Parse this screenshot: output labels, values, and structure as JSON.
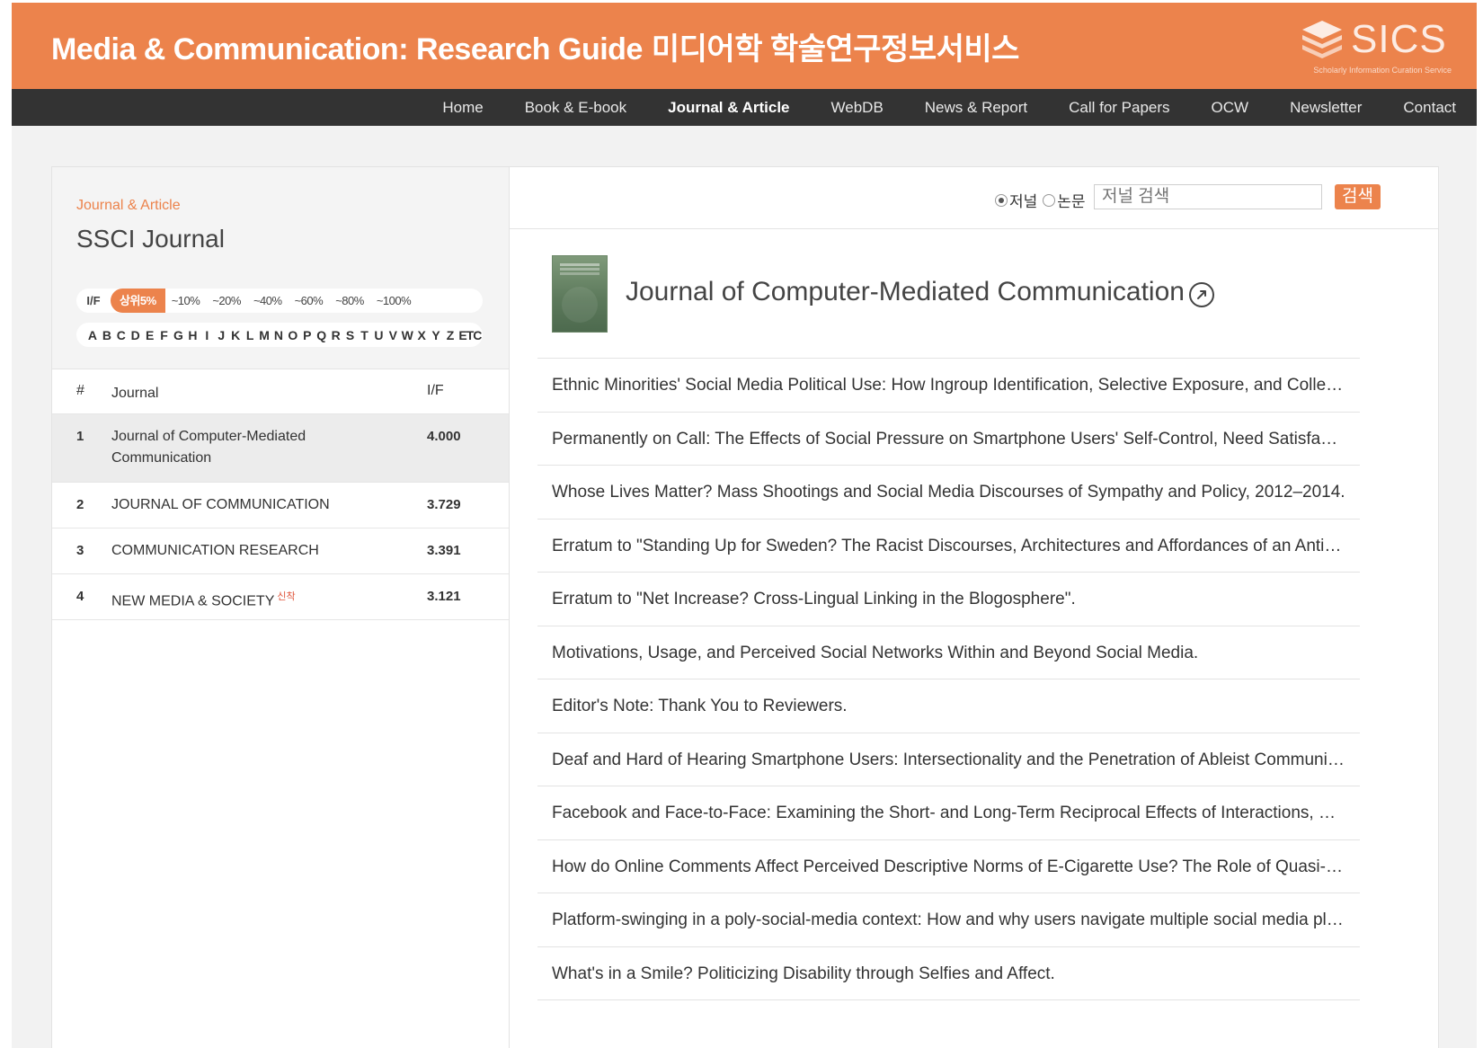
{
  "header": {
    "title_en": "Media & Communication: Research Guide",
    "title_ko": "미디어학 학술연구정보서비스",
    "logo_text": "SICS",
    "logo_sub": "Scholarly Information Curation Service"
  },
  "nav": {
    "items": [
      {
        "label": "Home",
        "active": false
      },
      {
        "label": "Book & E-book",
        "active": false
      },
      {
        "label": "Journal & Article",
        "active": true
      },
      {
        "label": "WebDB",
        "active": false
      },
      {
        "label": "News & Report",
        "active": false
      },
      {
        "label": "Call for Papers",
        "active": false
      },
      {
        "label": "OCW",
        "active": false
      },
      {
        "label": "Newsletter",
        "active": false
      },
      {
        "label": "Contact",
        "active": false
      }
    ]
  },
  "sidebar": {
    "breadcrumb": "Journal & Article",
    "title": "SSCI Journal",
    "if_label": "I/F",
    "if_filters": [
      "상위5%",
      "~10%",
      "~20%",
      "~40%",
      "~60%",
      "~80%",
      "~100%"
    ],
    "if_selected": "상위5%",
    "alphabet": [
      "A",
      "B",
      "C",
      "D",
      "E",
      "F",
      "G",
      "H",
      "I",
      "J",
      "K",
      "L",
      "M",
      "N",
      "O",
      "P",
      "Q",
      "R",
      "S",
      "T",
      "U",
      "V",
      "W",
      "X",
      "Y",
      "Z",
      "ETC"
    ],
    "table": {
      "col_num": "#",
      "col_journal": "Journal",
      "col_if": "I/F",
      "rows": [
        {
          "num": "1",
          "name": "Journal of Computer-Mediated Communication",
          "if": "4.000",
          "selected": true,
          "badge": ""
        },
        {
          "num": "2",
          "name": "JOURNAL OF COMMUNICATION",
          "if": "3.729",
          "selected": false,
          "badge": ""
        },
        {
          "num": "3",
          "name": "COMMUNICATION RESEARCH",
          "if": "3.391",
          "selected": false,
          "badge": ""
        },
        {
          "num": "4",
          "name": "NEW MEDIA & SOCIETY",
          "if": "3.121",
          "selected": false,
          "badge": "신착"
        }
      ]
    }
  },
  "search": {
    "radio_journal": "저널",
    "radio_paper": "논문",
    "selected": "저널",
    "placeholder": "저널 검색",
    "button": "검색"
  },
  "journal": {
    "title": "Journal of Computer-Mediated Communication",
    "articles": [
      "Ethnic Minorities' Social Media Political Use: How Ingroup Identification, Selective Exposure, and Collectiv…",
      "Permanently on Call: The Effects of Social Pressure on Smartphone Users' Self-Control, Need Satisfaction, …",
      "Whose Lives Matter? Mass Shootings and Social Media Discourses of Sympathy and Policy, 2012–2014.",
      "Erratum to \"Standing Up for Sweden? The Racist Discourses, Architectures and Affordances of an Anti-Im…",
      "Erratum to \"Net Increase? Cross-Lingual Linking in the Blogosphere\".",
      "Motivations, Usage, and Perceived Social Networks Within and Beyond Social Media.",
      "Editor's Note: Thank You to Reviewers.",
      "Deaf and Hard of Hearing Smartphone Users: Intersectionality and the Penetration of Ableist Communicat…",
      "Facebook and Face-to-Face: Examining the Short- and Long-Term Reciprocal Effects of Interactions, Percei…",
      "How do Online Comments Affect Perceived Descriptive Norms of E-Cigarette Use? The Role of Quasi-Statis…",
      "Platform-swinging in a poly-social-media context: How and why users navigate multiple social media platf…",
      "What's in a Smile? Politicizing Disability through Selfies and Affect."
    ]
  },
  "colors": {
    "accent": "#ec834c",
    "nav_bg": "#333333"
  }
}
